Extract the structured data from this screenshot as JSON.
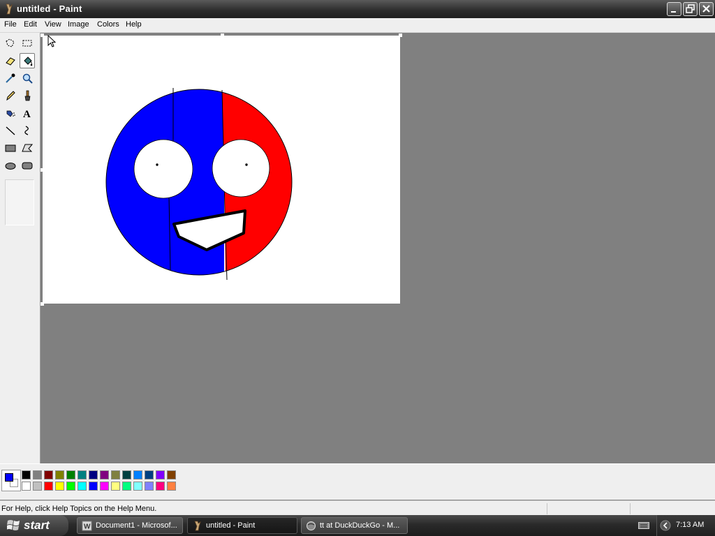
{
  "window": {
    "title": "untitled - Paint"
  },
  "menu": {
    "items": [
      "File",
      "Edit",
      "View",
      "Image",
      "Colors",
      "Help"
    ]
  },
  "toolbox": {
    "tools": [
      {
        "name": "free-form-select-icon"
      },
      {
        "name": "rect-select-icon"
      },
      {
        "name": "eraser-icon"
      },
      {
        "name": "fill-bucket-icon",
        "selected": true
      },
      {
        "name": "color-picker-icon"
      },
      {
        "name": "magnifier-icon"
      },
      {
        "name": "pencil-icon"
      },
      {
        "name": "brush-icon"
      },
      {
        "name": "airbrush-icon"
      },
      {
        "name": "text-icon"
      },
      {
        "name": "line-icon"
      },
      {
        "name": "curve-icon"
      },
      {
        "name": "rectangle-icon"
      },
      {
        "name": "polygon-icon"
      },
      {
        "name": "ellipse-icon"
      },
      {
        "name": "rounded-rect-icon"
      }
    ]
  },
  "palette": {
    "foreground": "#0000ff",
    "background": "#ffffff",
    "row1": [
      "#000000",
      "#808080",
      "#800000",
      "#808000",
      "#008000",
      "#008080",
      "#000080",
      "#800080",
      "#808040",
      "#004040",
      "#0080ff",
      "#004080",
      "#8000ff",
      "#804000"
    ],
    "row2": [
      "#ffffff",
      "#c0c0c0",
      "#ff0000",
      "#ffff00",
      "#00ff00",
      "#00ffff",
      "#0000ff",
      "#ff00ff",
      "#ffff80",
      "#00ff80",
      "#80ffff",
      "#8080ff",
      "#ff0080",
      "#ff8040"
    ]
  },
  "status": {
    "text": "For Help, click Help Topics on the Help Menu."
  },
  "taskbar": {
    "start_label": "start",
    "tasks": [
      {
        "label": "Document1 - Microsof...",
        "icon": "word-icon",
        "active": false
      },
      {
        "label": "untitled - Paint",
        "icon": "paint-icon",
        "active": true
      },
      {
        "label": "tt at DuckDuckGo - M...",
        "icon": "browser-icon",
        "active": false
      }
    ],
    "clock": "7:13 AM"
  }
}
